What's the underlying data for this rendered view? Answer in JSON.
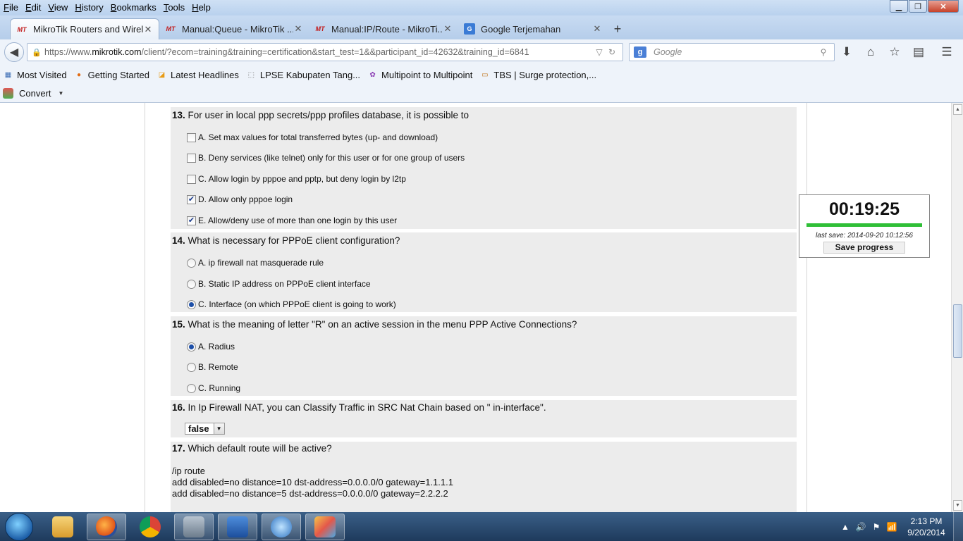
{
  "menu": {
    "items": [
      {
        "label": "File",
        "u": "F",
        "rest": "ile"
      },
      {
        "label": "Edit",
        "u": "E",
        "rest": "dit"
      },
      {
        "label": "View",
        "u": "V",
        "rest": "iew"
      },
      {
        "label": "History",
        "u": "H",
        "rest": "istory"
      },
      {
        "label": "Bookmarks",
        "u": "B",
        "rest": "ookmarks"
      },
      {
        "label": "Tools",
        "u": "T",
        "rest": "ools"
      },
      {
        "label": "Help",
        "u": "H",
        "rest": "elp"
      }
    ]
  },
  "window_controls": {
    "minimize": "▁",
    "restore": "❐",
    "close": "✕"
  },
  "tabs": [
    {
      "favicon": "MT",
      "title": "MikroTik Routers and Wirel...",
      "close": "✕"
    },
    {
      "favicon": "MT",
      "title": "Manual:Queue - MikroTik ...",
      "close": "✕"
    },
    {
      "favicon": "MT",
      "title": "Manual:IP/Route - MikroTi...",
      "close": "✕"
    },
    {
      "favicon": "G",
      "title": "Google Terjemahan",
      "close": "✕"
    }
  ],
  "new_tab": "+",
  "nav": {
    "back": "◀",
    "url_prefix": "https://www.",
    "url_domain": "mikrotik.com",
    "url_rest": "/client/?ecom=training&training=certification&start_test=1&&participant_id=42632&training_id=6841",
    "url_dropdown": "▽",
    "reload": "↻",
    "search_engine": "g",
    "search_placeholder": "Google",
    "search_icon": "⚲",
    "download_icon": "⬇",
    "home_icon": "⌂",
    "bookmark_icon": "☆",
    "reader_icon": "▤",
    "menu_icon": "☰"
  },
  "bookmarks": [
    {
      "icon": "▦",
      "label": "Most Visited"
    },
    {
      "icon": "●",
      "label": "Getting Started"
    },
    {
      "icon": "◪",
      "label": "Latest Headlines"
    },
    {
      "icon": "⬚",
      "label": "LPSE Kabupaten Tang..."
    },
    {
      "icon": "✿",
      "label": "Multipoint to Multipoint"
    },
    {
      "icon": "▭",
      "label": "TBS | Surge protection,..."
    }
  ],
  "convert": {
    "label": "Convert",
    "caret": "▼"
  },
  "questions": {
    "q13": {
      "number": "13.",
      "text": " For user in local ppp secrets/ppp profiles database, it is possible to",
      "options": [
        {
          "text": "A. Set max values for total transferred bytes (up- and download)",
          "checked": false
        },
        {
          "text": "B. Deny services (like telnet) only for this user or for one group of users",
          "checked": false
        },
        {
          "text": "C. Allow login by pppoe and pptp, but deny login by l2tp",
          "checked": false
        },
        {
          "text": "D. Allow only pppoe login",
          "checked": true
        },
        {
          "text": "E. Allow/deny use of more than one login by this user",
          "checked": true
        }
      ]
    },
    "q14": {
      "number": "14.",
      "text": " What is necessary for PPPoE client configuration?",
      "options": [
        {
          "text": "A. ip firewall nat masquerade rule",
          "selected": false
        },
        {
          "text": "B. Static IP address on PPPoE client interface",
          "selected": false
        },
        {
          "text": "C. Interface (on which PPPoE client is going to work)",
          "selected": true
        }
      ]
    },
    "q15": {
      "number": "15.",
      "text": " What is the meaning of letter \"R\" on an active session in the menu PPP Active Connections?",
      "options": [
        {
          "text": "A. Radius",
          "selected": true
        },
        {
          "text": "B. Remote",
          "selected": false
        },
        {
          "text": "C. Running",
          "selected": false
        }
      ]
    },
    "q16": {
      "number": "16.",
      "text": " In Ip Firewall NAT, you can Classify Traffic in SRC Nat Chain based on \" in-interface\".",
      "select_value": "false",
      "select_arrow": "▼"
    },
    "q17": {
      "number": "17.",
      "text": " Which default route will be active?",
      "code": [
        "/ip route",
        "add disabled=no distance=10 dst-address=0.0.0.0/0 gateway=1.1.1.1",
        "add disabled=no distance=5 dst-address=0.0.0.0/0 gateway=2.2.2.2"
      ]
    }
  },
  "timer": {
    "value": "00:19:25",
    "last_save": "last save: 2014-09-20 10:12:56",
    "save_button": "Save progress"
  },
  "scrollbar": {
    "up": "▲",
    "down": "▼"
  },
  "tray": {
    "show_hidden": "▲",
    "volume": "🔊",
    "flag": "⚑",
    "network": "📶",
    "time": "2:13 PM",
    "date": "9/20/2014"
  },
  "colors": {
    "accent": "#1d4fa8",
    "timer_bar": "#2fbf37",
    "question_bg": "#ececec",
    "mikrotik_red": "#c21d1d"
  }
}
